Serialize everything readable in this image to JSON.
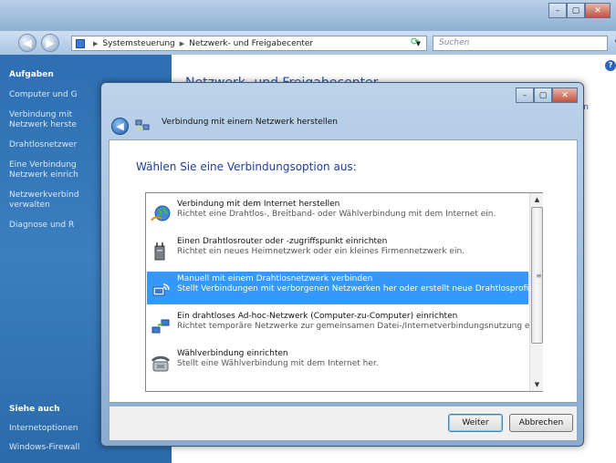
{
  "window": {
    "buttons": [
      "–",
      "▢",
      "✕"
    ]
  },
  "navbar": {
    "breadcrumb": [
      "Systemsteuerung",
      "Netzwerk- und Freigabecenter"
    ],
    "search_placeholder": "Suchen"
  },
  "sidebar": {
    "aufgaben_header": "Aufgaben",
    "items": [
      "Computer und G",
      "Verbindung mit",
      "Netzwerk herste",
      "Drahtlosnetzwer",
      "Eine Verbindung",
      "Netzwerk einrich",
      "Netzwerkverbind",
      "verwalten",
      "Diagnose und R"
    ],
    "siehe_auch_header": "Siehe auch",
    "see_also": [
      "Internetoptionen",
      "Windows-Firewall"
    ]
  },
  "main": {
    "title": "Netzwerk- und Freigabecenter",
    "right_text": "gen"
  },
  "dialog": {
    "title": "Verbindung mit einem Netzwerk herstellen",
    "heading": "Wählen Sie eine Verbindungsoption aus:",
    "options": [
      {
        "title": "Verbindung mit dem Internet herstellen",
        "desc": "Richtet eine Drahtlos-, Breitband- oder Wählverbindung mit dem Internet ein.",
        "icon": "globe-icon",
        "selected": false
      },
      {
        "title": "Einen Drahtlosrouter oder -zugriffspunkt einrichten",
        "desc": "Richtet ein neues Heimnetzwerk oder ein kleines Firmennetzwerk ein.",
        "icon": "router-icon",
        "selected": false
      },
      {
        "title": "Manuell mit einem Drahtlosnetzwerk verbinden",
        "desc": "Stellt Verbindungen mit verborgenen Netzwerken her oder erstellt neue Drahtlosprofile.",
        "icon": "wireless-network-icon",
        "selected": true
      },
      {
        "title": "Ein drahtloses Ad-hoc-Netzwerk (Computer-zu-Computer) einrichten",
        "desc": "Richtet temporäre Netzwerke zur gemeinsamen Datei-/Internetverbindungsnutzung ein.",
        "icon": "adhoc-network-icon",
        "selected": false
      },
      {
        "title": "Wählverbindung einrichten",
        "desc": "Stellt eine Wählverbindung mit dem Internet her.",
        "icon": "dialup-phone-icon",
        "selected": false
      }
    ],
    "next_label": "Weiter",
    "cancel_label": "Abbrechen"
  },
  "colors": {
    "sidebar": "#3b7fbf",
    "selection": "#3399ff",
    "heading": "#1e3f9a"
  }
}
